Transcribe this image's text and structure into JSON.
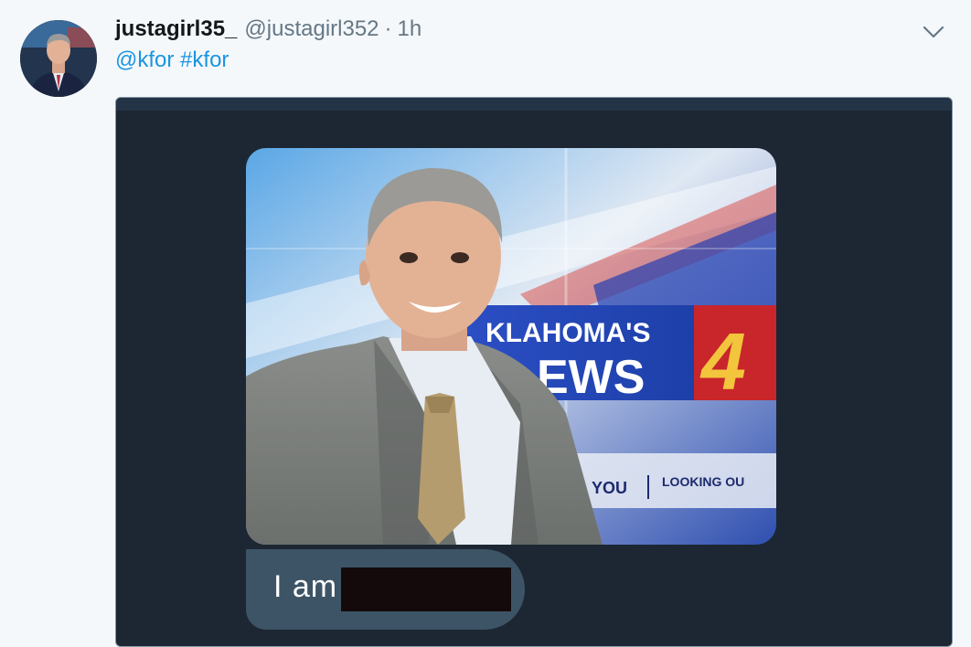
{
  "tweet": {
    "display_name": "justagirl35_",
    "username": "@justagirl352",
    "separator": "·",
    "time": "1h",
    "text_mention": "@kfor",
    "text_hashtag": "#kfor",
    "menu_icon": "chevron-down-icon",
    "avatar_icon": "avatar"
  },
  "media": {
    "backdrop_text_line1": "KLAHOMA'S",
    "backdrop_text_line2": "EWS",
    "backdrop_number": "4",
    "backdrop_strap_left": "YOU",
    "backdrop_strap_right": "LOOKING OU",
    "caption": "I am"
  },
  "colors": {
    "link": "#1b95e0",
    "card_background": "#1c2733",
    "bubble": "#3d5466",
    "redaction": "#140a0b"
  }
}
